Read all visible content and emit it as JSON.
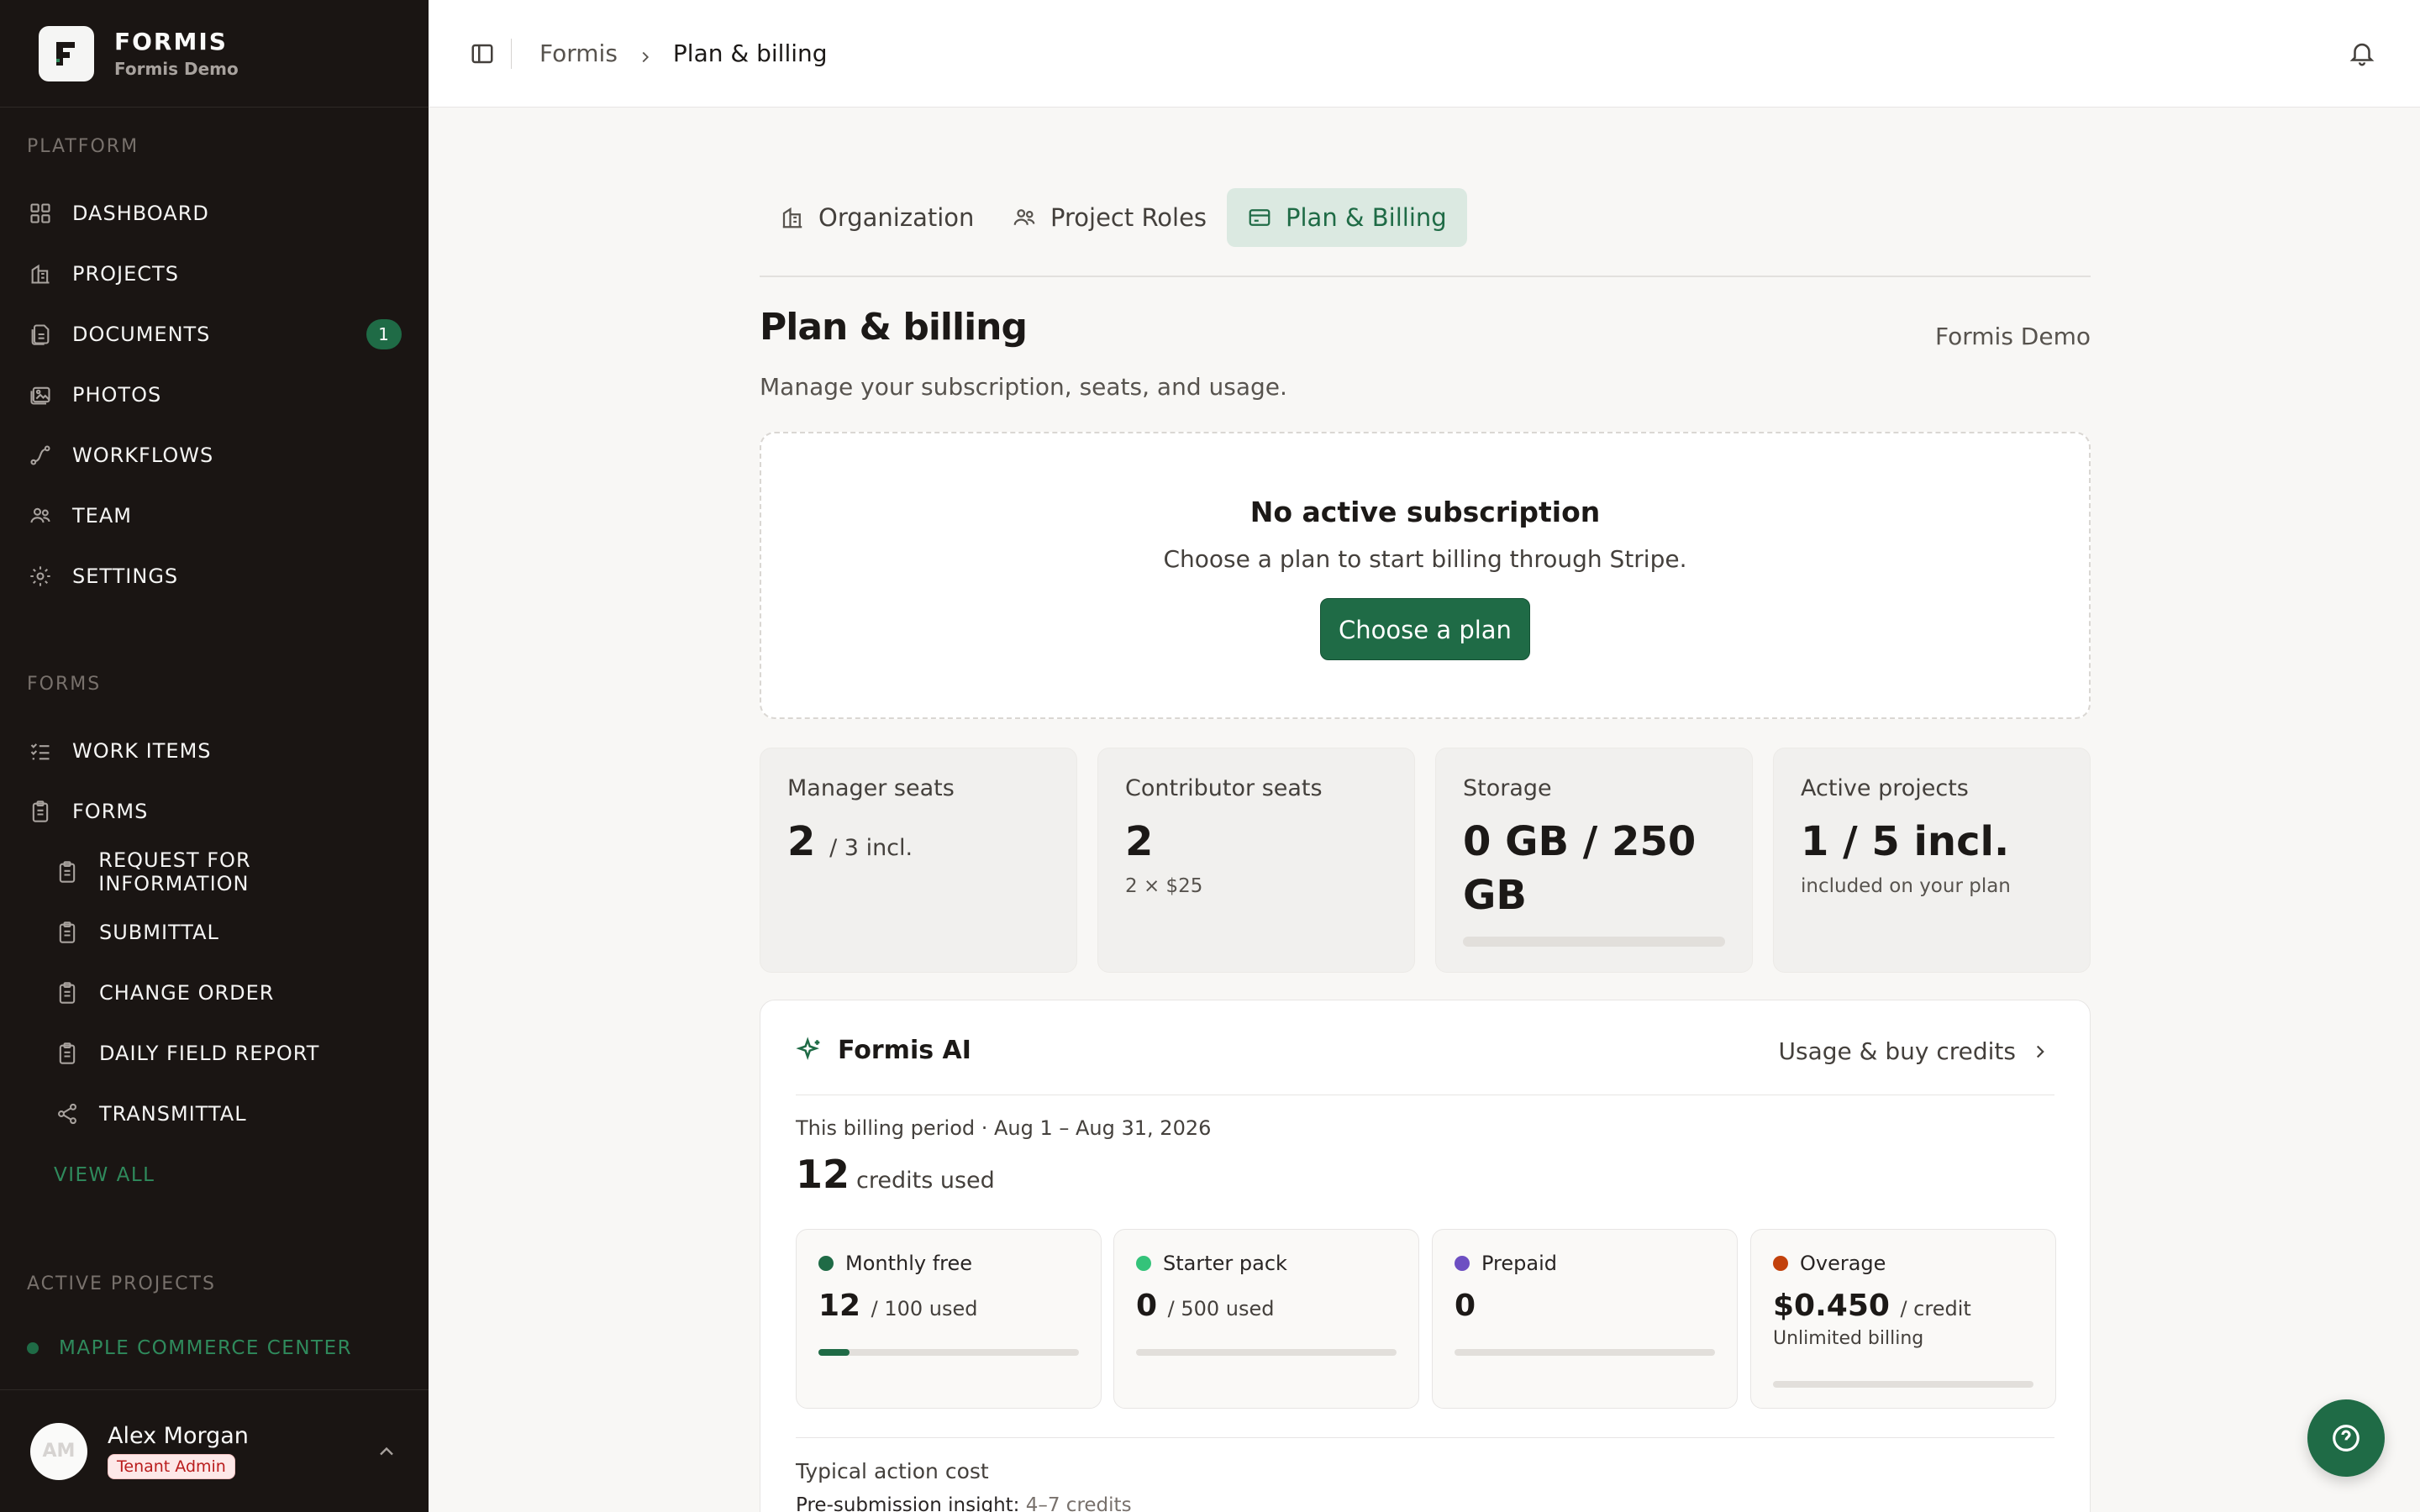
{
  "brand": {
    "name": "FORMIS",
    "workspace": "Formis Demo"
  },
  "sidebar": {
    "platform_label": "PLATFORM",
    "platform_items": [
      {
        "label": "DASHBOARD",
        "icon": "grid-icon"
      },
      {
        "label": "PROJECTS",
        "icon": "building-icon"
      },
      {
        "label": "DOCUMENTS",
        "icon": "documents-icon",
        "badge": "1"
      },
      {
        "label": "PHOTOS",
        "icon": "photos-icon"
      },
      {
        "label": "WORKFLOWS",
        "icon": "workflow-icon"
      },
      {
        "label": "TEAM",
        "icon": "team-icon"
      },
      {
        "label": "SETTINGS",
        "icon": "gear-icon"
      }
    ],
    "forms_label": "FORMS",
    "forms_items": [
      {
        "label": "WORK ITEMS",
        "icon": "checklist-icon"
      },
      {
        "label": "FORMS",
        "icon": "clipboard-icon"
      }
    ],
    "form_types": [
      {
        "label": "REQUEST FOR INFORMATION",
        "icon": "clipboard-icon"
      },
      {
        "label": "SUBMITTAL",
        "icon": "clipboard-icon"
      },
      {
        "label": "CHANGE ORDER",
        "icon": "clipboard-icon"
      },
      {
        "label": "DAILY FIELD REPORT",
        "icon": "clipboard-icon"
      },
      {
        "label": "TRANSMITTAL",
        "icon": "share-icon"
      }
    ],
    "view_all": "VIEW ALL",
    "active_projects_label": "ACTIVE PROJECTS",
    "active_projects": [
      {
        "label": "MAPLE COMMERCE CENTER"
      }
    ],
    "user": {
      "initials": "AM",
      "name": "Alex Morgan",
      "role": "Tenant Admin"
    }
  },
  "breadcrumb": {
    "parent": "Formis",
    "current": "Plan & billing"
  },
  "tabs": [
    {
      "label": "Organization",
      "icon": "building-icon",
      "active": false
    },
    {
      "label": "Project Roles",
      "icon": "team-icon",
      "active": false
    },
    {
      "label": "Plan & Billing",
      "icon": "credit-card-icon",
      "active": true
    }
  ],
  "page": {
    "title": "Plan & billing",
    "org": "Formis Demo",
    "subtitle": "Manage your subscription, seats, and usage."
  },
  "no_subscription": {
    "title": "No active subscription",
    "text": "Choose a plan to start billing through Stripe.",
    "button": "Choose a plan"
  },
  "stats": [
    {
      "label": "Manager seats",
      "value": "2",
      "suffix": "/ 3 incl.",
      "note": ""
    },
    {
      "label": "Contributor seats",
      "value": "2",
      "suffix": "",
      "note": "2 × $25"
    },
    {
      "label": "Storage",
      "value": "0 GB / 250 GB",
      "suffix": "",
      "note": "",
      "fraction": 0
    },
    {
      "label": "Active projects",
      "value": "1 / 5 incl.",
      "suffix": "",
      "note": "included on your plan"
    }
  ],
  "ai": {
    "title": "Formis AI",
    "link": "Usage & buy credits",
    "period": "This billing period · Aug 1 – Aug 31, 2026",
    "credits_used": "12",
    "credits_label": "credits used",
    "buckets": [
      {
        "label": "Monthly free",
        "color": "#1f6b46",
        "value": "12",
        "suffix": "/ 100 used",
        "note": "",
        "fraction": 0.12
      },
      {
        "label": "Starter pack",
        "color": "#34c37a",
        "value": "0",
        "suffix": "/ 500 used",
        "note": "",
        "fraction": 0
      },
      {
        "label": "Prepaid",
        "color": "#6d4fc2",
        "value": "0",
        "suffix": "",
        "note": "",
        "fraction": 0
      },
      {
        "label": "Overage",
        "color": "#c2410c",
        "value": "$0.450",
        "suffix": "/ credit",
        "note": "Unlimited billing",
        "fraction": 0
      }
    ],
    "cost_label": "Typical action cost",
    "cost_item": "Pre-submission insight:",
    "cost_value": "4–7 credits"
  }
}
